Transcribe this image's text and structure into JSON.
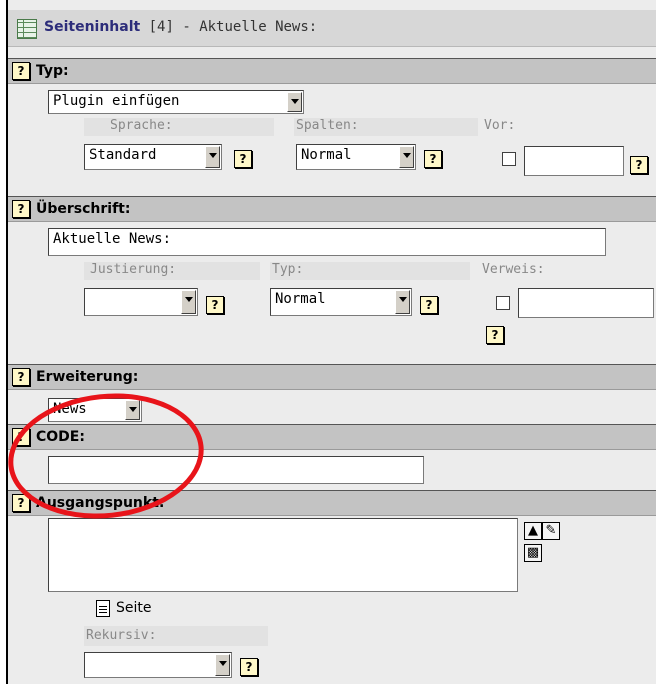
{
  "header": {
    "title_bold": "Seiteninhalt",
    "title_rest": " [4] - Aktuelle News:"
  },
  "sections": {
    "typ": {
      "label": "Typ:",
      "select_value": "Plugin einfügen",
      "sprache_label": "Sprache:",
      "sprache_value": "Standard",
      "spalten_label": "Spalten:",
      "spalten_value": "Normal",
      "vor_label": "Vor:"
    },
    "ueberschrift": {
      "label": "Überschrift:",
      "value": "Aktuelle News:",
      "justierung_label": "Justierung:",
      "justierung_value": "",
      "typ_label": "Typ:",
      "typ_value": "Normal",
      "verweis_label": "Verweis:"
    },
    "erweiterung": {
      "label": "Erweiterung:",
      "value": "News"
    },
    "code": {
      "label": "CODE:",
      "value": ""
    },
    "ausgangspunkt": {
      "label": "Ausgangspunkt:",
      "seite_label": "Seite",
      "rekursiv_label": "Rekursiv:",
      "rekursiv_value": ""
    }
  },
  "help_glyph": "?",
  "icons": [
    "table-icon",
    "help-icon",
    "move-up-icon",
    "browse-icon",
    "trash-icon",
    "page-icon"
  ],
  "annotation_color": "#e8141a"
}
